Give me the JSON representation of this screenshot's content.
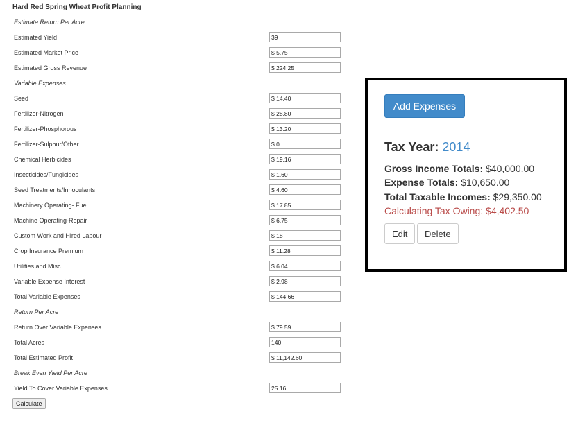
{
  "form": {
    "title": "Hard Red Spring Wheat Profit Planning",
    "rows": [
      {
        "label": "Estimate Return Per Acre",
        "section": true
      },
      {
        "label": "Estimated Yield",
        "value": "39"
      },
      {
        "label": "Estimated Market Price",
        "value": "$ 5.75"
      },
      {
        "label": "Estimated Gross Revenue",
        "value": "$ 224.25"
      },
      {
        "label": "Variable Expenses",
        "section": true
      },
      {
        "label": "Seed",
        "value": "$ 14.40"
      },
      {
        "label": "Fertilizer-Nitrogen",
        "value": "$ 28.80"
      },
      {
        "label": "Fertilizer-Phosphorous",
        "value": "$ 13.20"
      },
      {
        "label": "Fertilizer-Sulphur/Other",
        "value": "$ 0"
      },
      {
        "label": "Chemical Herbicides",
        "value": "$ 19.16"
      },
      {
        "label": "Insecticides/Fungicides",
        "value": "$ 1.60"
      },
      {
        "label": "Seed Treatments/Innoculants",
        "value": "$ 4.60"
      },
      {
        "label": "Machinery Operating- Fuel",
        "value": "$ 17.85"
      },
      {
        "label": "Machine Operating-Repair",
        "value": "$ 6.75"
      },
      {
        "label": "Custom Work and Hired Labour",
        "value": "$ 18"
      },
      {
        "label": "Crop Insurance Premium",
        "value": "$ 11.28"
      },
      {
        "label": "Utilities and Misc",
        "value": "$ 6.04"
      },
      {
        "label": "Variable Expense Interest",
        "value": "$ 2.98"
      },
      {
        "label": "Total Variable Expenses",
        "value": "$ 144.66"
      },
      {
        "label": "Return Per Acre",
        "section": true
      },
      {
        "label": "Return Over Variable Expenses",
        "value": "$ 79.59"
      },
      {
        "label": "Total Acres",
        "value": "140"
      },
      {
        "label": "Total Estimated Profit",
        "value": "$ 11,142.60"
      },
      {
        "label": "Break Even Yield Per Acre",
        "section": true
      },
      {
        "label": "Yield To Cover Variable Expenses",
        "value": "25.16"
      }
    ],
    "calculate_label": "Calculate"
  },
  "panel": {
    "add_expenses_label": "Add Expenses",
    "tax_year_label": "Tax Year:",
    "tax_year": "2014",
    "gross_income_label": "Gross Income Totals:",
    "gross_income_value": "$40,000.00",
    "expense_label": "Expense Totals:",
    "expense_value": "$10,650.00",
    "taxable_label": "Total Taxable Incomes:",
    "taxable_value": "$29,350.00",
    "owing_text": "Calculating Tax Owing: $4,402.50",
    "edit_label": "Edit",
    "delete_label": "Delete",
    "colors": {
      "primary": "#428bca",
      "danger": "#b94a48",
      "border": "#000000"
    }
  }
}
